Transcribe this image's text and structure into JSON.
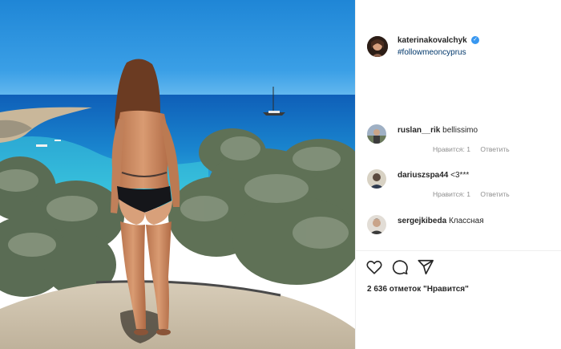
{
  "post": {
    "author": {
      "username": "katerinakovalchyk",
      "verified": true,
      "avatar": "avatar-photo"
    },
    "caption_hashtag": "#followmeoncyprus",
    "comments": [
      {
        "username": "ruslan__rik",
        "text": "bellissimo",
        "likes_label": "Нравится: 1",
        "reply_label": "Ответить"
      },
      {
        "username": "dariuszspa44",
        "text": "<3***",
        "likes_label": "Нравится: 1",
        "reply_label": "Ответить"
      },
      {
        "username": "sergejkibeda",
        "text": "Классная"
      }
    ],
    "actions": {
      "like_icon": "heart-icon",
      "comment_icon": "comment-icon",
      "share_icon": "share-icon"
    },
    "likes_text": "2 636 отметок \"Нравится\""
  },
  "colors": {
    "verified_badge": "#3897f0",
    "hashtag": "#00376b",
    "meta_text": "#8e8e8e",
    "primary_text": "#262626",
    "divider": "#efefef"
  }
}
